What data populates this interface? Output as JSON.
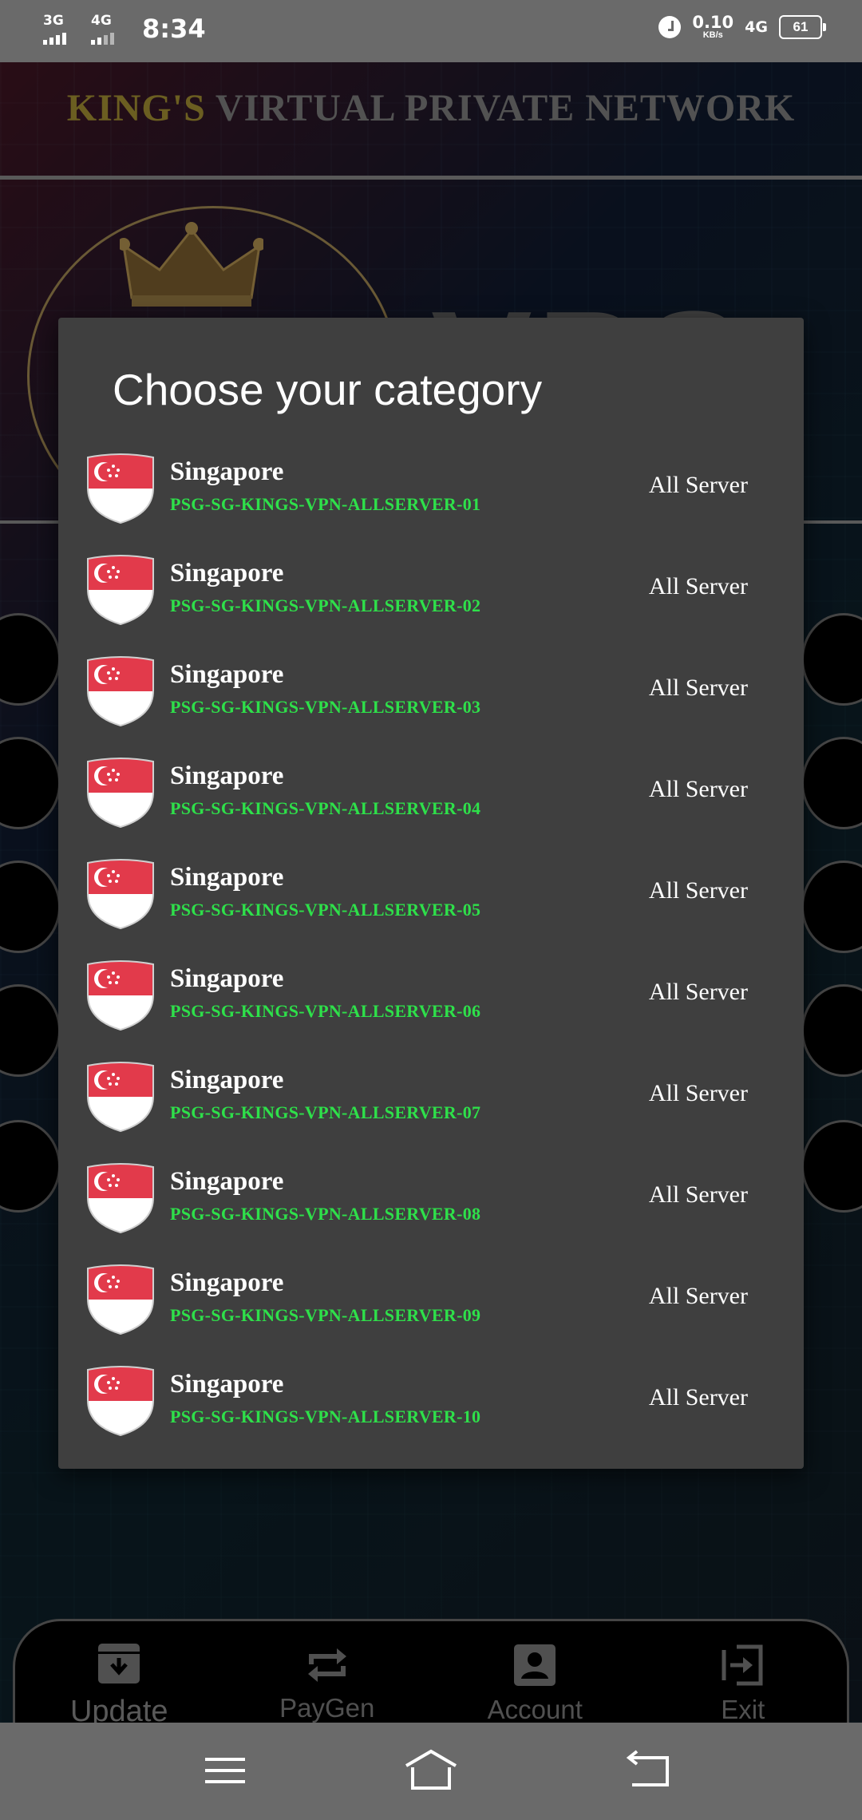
{
  "status_bar": {
    "net1": "3G",
    "net2": "4G",
    "time": "8:34",
    "speed_value": "0.10",
    "speed_unit": "KB/s",
    "net3": "4G",
    "battery": "61"
  },
  "app": {
    "title_part1": "KING'S",
    "title_part2": "VIRTUAL PRIVATE NETWORK",
    "logo_text": "VPS"
  },
  "dialog": {
    "title": "Choose your category",
    "servers": [
      {
        "country": "Singapore",
        "id": "PSG-SG-KINGS-VPN-ALLSERVER-01",
        "type": "All Server"
      },
      {
        "country": "Singapore",
        "id": "PSG-SG-KINGS-VPN-ALLSERVER-02",
        "type": "All Server"
      },
      {
        "country": "Singapore",
        "id": "PSG-SG-KINGS-VPN-ALLSERVER-03",
        "type": "All Server"
      },
      {
        "country": "Singapore",
        "id": "PSG-SG-KINGS-VPN-ALLSERVER-04",
        "type": "All Server"
      },
      {
        "country": "Singapore",
        "id": "PSG-SG-KINGS-VPN-ALLSERVER-05",
        "type": "All Server"
      },
      {
        "country": "Singapore",
        "id": "PSG-SG-KINGS-VPN-ALLSERVER-06",
        "type": "All Server"
      },
      {
        "country": "Singapore",
        "id": "PSG-SG-KINGS-VPN-ALLSERVER-07",
        "type": "All Server"
      },
      {
        "country": "Singapore",
        "id": "PSG-SG-KINGS-VPN-ALLSERVER-08",
        "type": "All Server"
      },
      {
        "country": "Singapore",
        "id": "PSG-SG-KINGS-VPN-ALLSERVER-09",
        "type": "All Server"
      },
      {
        "country": "Singapore",
        "id": "PSG-SG-KINGS-VPN-ALLSERVER-10",
        "type": "All Server"
      }
    ]
  },
  "bottom_nav": {
    "items": [
      {
        "label": "Update",
        "icon": "archive-download-icon"
      },
      {
        "label": "PayGen",
        "icon": "repeat-icon"
      },
      {
        "label": "Account",
        "icon": "account-box-icon"
      },
      {
        "label": "Exit",
        "icon": "exit-icon"
      }
    ]
  },
  "colors": {
    "dialog_bg": "#3f3f3f",
    "server_id": "#2ee04a",
    "title_gold": "#b8a23a",
    "flag_red": "#e23a4b"
  }
}
